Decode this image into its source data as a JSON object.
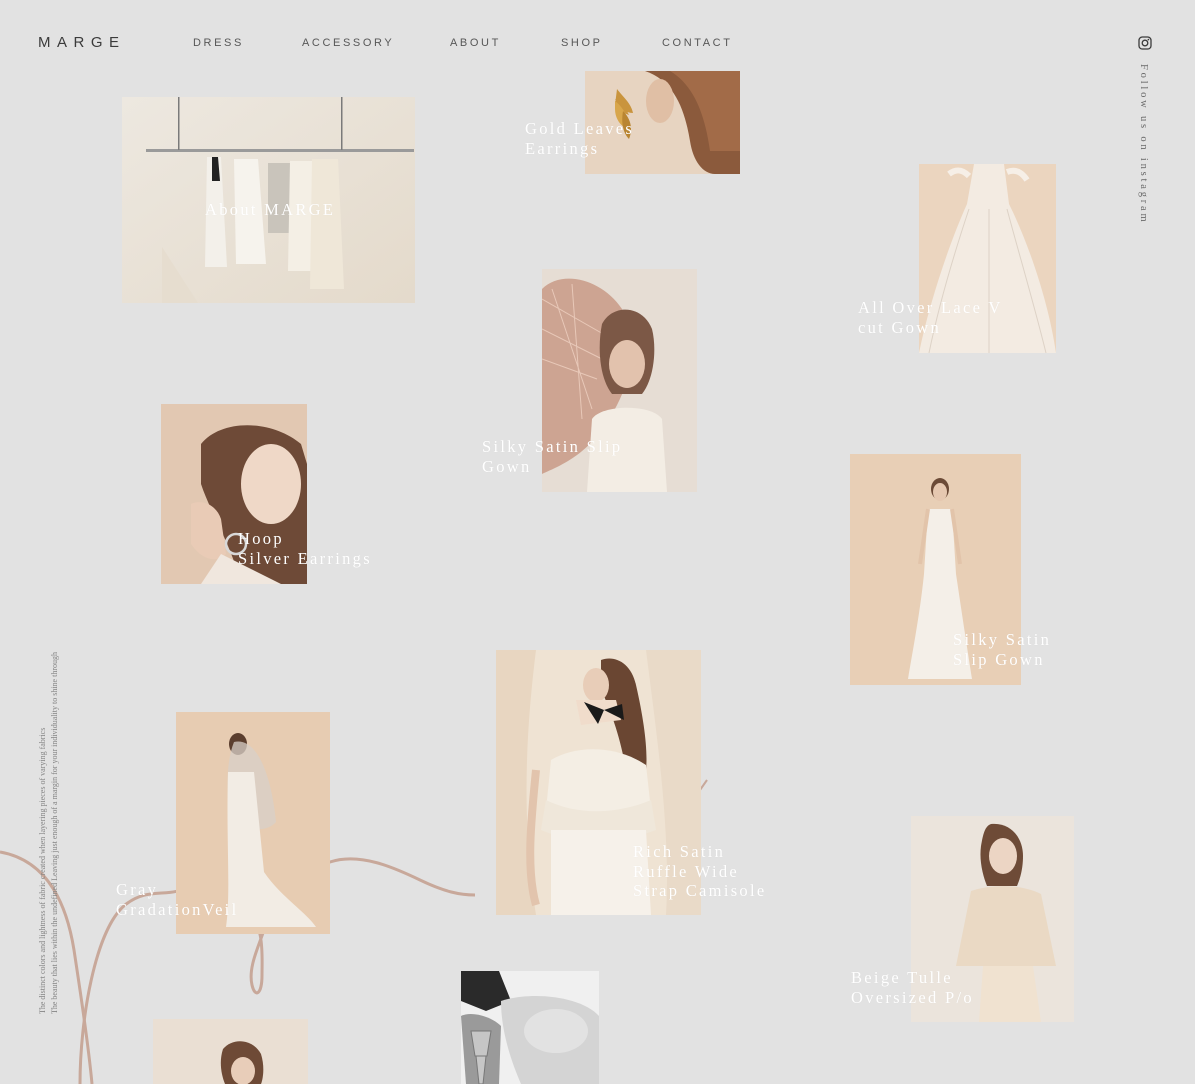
{
  "brand": {
    "logo": "MARGE"
  },
  "nav": {
    "items": [
      {
        "label": "DRESS"
      },
      {
        "label": "ACCESSORY"
      },
      {
        "label": "ABOUT"
      },
      {
        "label": "SHOP"
      },
      {
        "label": "CONTACT"
      }
    ]
  },
  "social": {
    "icon": "instagram-icon",
    "follow_text": "Follow us on instagram"
  },
  "side_text": {
    "line1": "The distinct colors and lightness of fabric created when layering pieces of varying fabrics",
    "line2": "The beauty that lies within the undefined Leaving just enough of a margin for your individuality to shine through"
  },
  "cards": [
    {
      "label": "About MARGE"
    },
    {
      "label": "Gold Leaves\nEarrings"
    },
    {
      "label": "All Over Lace V\ncut Gown"
    },
    {
      "label": "Silky Satin Slip\nGown"
    },
    {
      "label": "Hoop\nSilver Earrings"
    },
    {
      "label": "Silky Satin\nSlip Gown"
    },
    {
      "label": "Rich Satin\nRuffle Wide\nStrap Camisole"
    },
    {
      "label": "Gray\nGradationVeil"
    },
    {
      "label": "Beige Tulle\nOversized P/o"
    },
    {
      "label": ""
    },
    {
      "label": ""
    }
  ],
  "colors": {
    "background": "#e2e2e2",
    "accent_line": "#c8a89a",
    "photo_beige": "#e8d2bc",
    "photo_ivory": "#ece6dc",
    "label_text": "#ffffff"
  }
}
